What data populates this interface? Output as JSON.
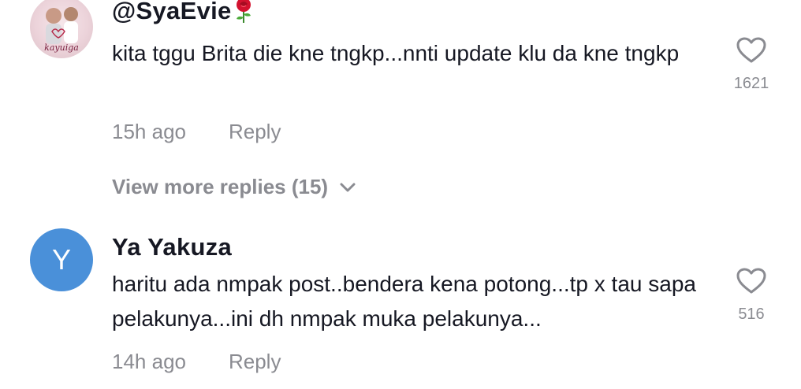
{
  "comments": [
    {
      "username": "@SyaEvie",
      "text": "kita tggu Brita die kne tngkp...nnti update klu da kne tngkp",
      "time": "15h ago",
      "reply_label": "Reply",
      "likes": "1621",
      "avatar_caption": "kayuiga"
    },
    {
      "username": "Ya Yakuza",
      "avatar_letter": "Y",
      "text": "haritu ada nmpak post..bendera kena potong...tp x tau sapa pelakunya...ini dh nmpak muka pelakunya...",
      "time": "14h ago",
      "reply_label": "Reply",
      "likes": "516"
    }
  ],
  "view_more_replies": "View more replies (15)",
  "colors": {
    "avatar_blue": "#4a90d9",
    "meta_gray": "#8a8b91",
    "text_dark": "#161823"
  },
  "icons": [
    "heart-icon",
    "rose-emoji-icon",
    "chevron-down-icon"
  ]
}
